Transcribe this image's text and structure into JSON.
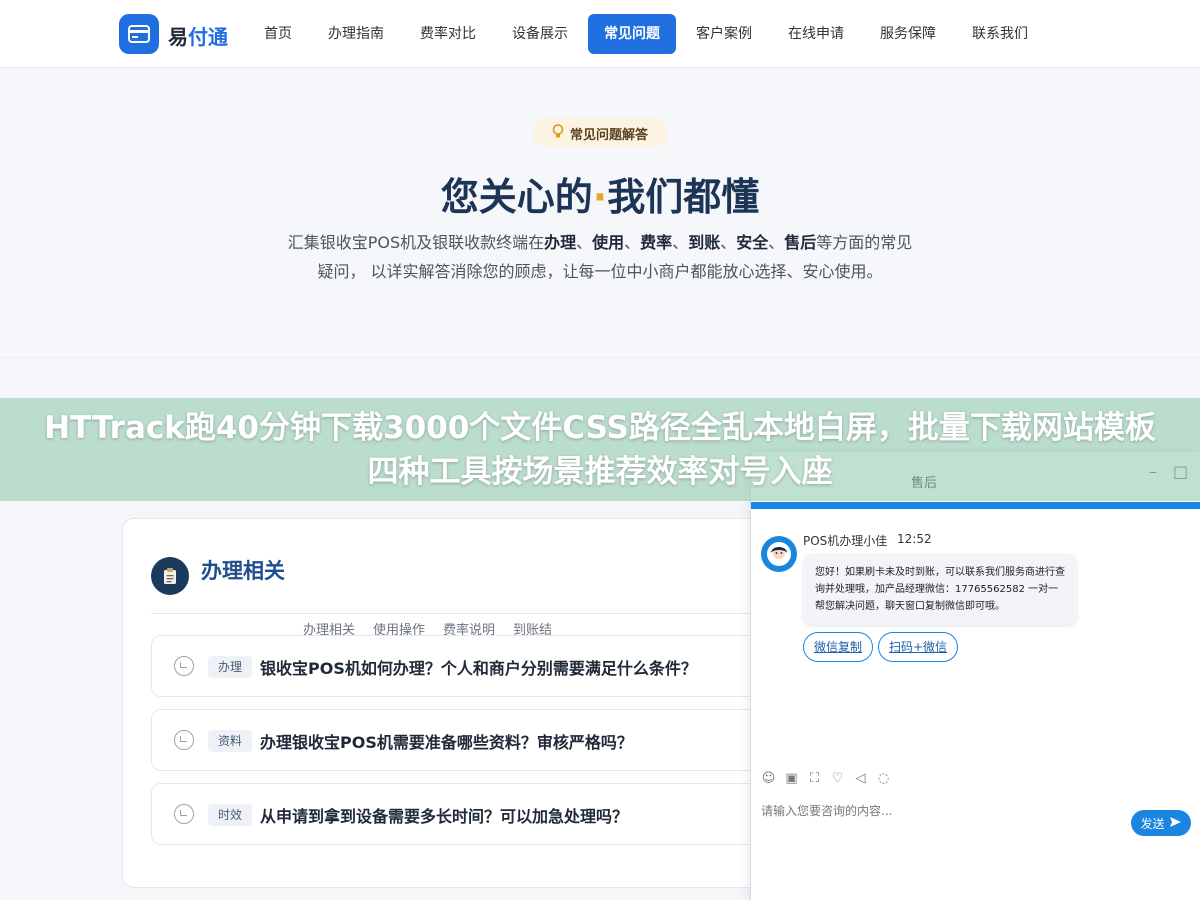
{
  "nav": {
    "logo_text_pre": "易",
    "logo_text_hl": "付通",
    "items": [
      "首页",
      "办理指南",
      "费率对比",
      "设备展示",
      "常见问题",
      "客户案例",
      "在线申请",
      "服务保障",
      "联系我们"
    ],
    "active_index": 4
  },
  "hero": {
    "pill": "常见问题解答",
    "title_left": "您关心的",
    "title_dot": "·",
    "title_right": "我们都懂",
    "desc_pre": "汇集银收宝POS机及银联收款终端在",
    "desc_b1": "办理",
    "desc_sep1": "、",
    "desc_b2": "使用",
    "desc_sep2": "、",
    "desc_b3": "费率",
    "desc_sep3": "、",
    "desc_b4": "到账",
    "desc_sep4": "、",
    "desc_b5": "安全",
    "desc_sep5": "、",
    "desc_b6": "售后",
    "desc_post": "等方面的常见疑问， 以详实解答消除您的顾虑，让每一位中小商户都能放心选择、安心使用。"
  },
  "section": {
    "title": "办理相关",
    "sub_tabs": [
      "办理相关",
      "使用操作",
      "费率说明",
      "到账结"
    ],
    "faqs": [
      {
        "tag": "办理",
        "question": "银收宝POS机如何办理？个人和商户分别需要满足什么条件？"
      },
      {
        "tag": "资料",
        "question": "办理银收宝POS机需要准备哪些资料？审核严格吗？"
      },
      {
        "tag": "时效",
        "question": "从申请到拿到设备需要多长时间？可以加急处理吗？"
      }
    ]
  },
  "banner": {
    "text": "HTTrack跑40分钟下载3000个文件CSS路径全乱本地白屏，批量下载网站模板四种工具按场景推荐效率对号入座"
  },
  "chat": {
    "header_title": "售后",
    "minimize": "–",
    "maximize": "□",
    "agent_name": "POS机办理小佳",
    "agent_time": "12:52",
    "message": "您好！如果刷卡未及时到账，可以联系我们服务商进行查询并处理哦，加产品经理微信：17765562582 一对一帮您解决问题，聊天窗口复制微信即可哦。",
    "quick_replies": [
      "微信复制",
      "扫码+微信"
    ],
    "input_placeholder": "请输入您要咨询的内容...",
    "send_label": "发送"
  },
  "colors": {
    "primary": "#1f6fe0",
    "navy": "#1c3557",
    "accent": "#e2a72e",
    "chat_blue": "#1a86e0"
  }
}
